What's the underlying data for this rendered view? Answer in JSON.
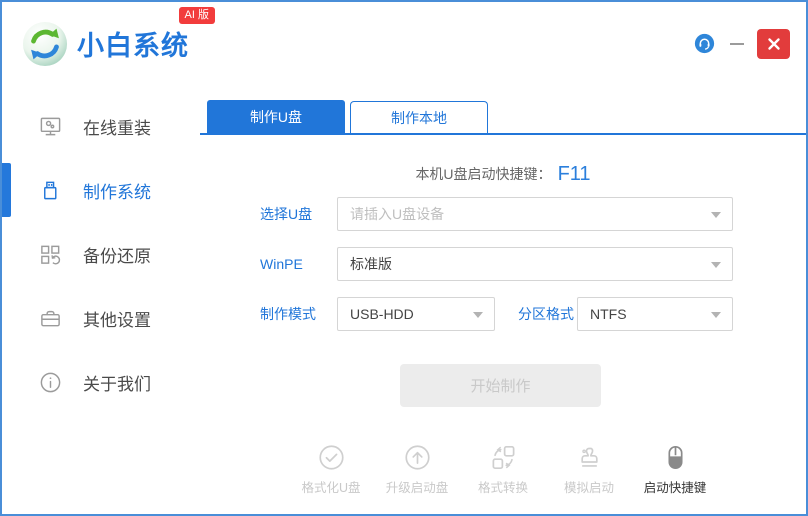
{
  "header": {
    "title": "小白系统",
    "badge": "AI 版"
  },
  "sidebar": {
    "items": [
      {
        "label": "在线重装",
        "icon": "monitor-icon",
        "active": false
      },
      {
        "label": "制作系统",
        "icon": "usb-drive-icon",
        "active": true
      },
      {
        "label": "备份还原",
        "icon": "backup-restore-icon",
        "active": false
      },
      {
        "label": "其他设置",
        "icon": "briefcase-icon",
        "active": false
      },
      {
        "label": "关于我们",
        "icon": "info-icon",
        "active": false
      }
    ]
  },
  "main": {
    "tabs": [
      {
        "label": "制作U盘",
        "active": true
      },
      {
        "label": "制作本地",
        "active": false
      }
    ],
    "hotkey_label": "本机U盘启动快捷键：",
    "hotkey_value": "F11",
    "form": {
      "usb_label": "选择U盘",
      "usb_placeholder": "请插入U盘设备",
      "winpe_label": "WinPE",
      "winpe_value": "标准版",
      "mode_label": "制作模式",
      "mode_value": "USB-HDD",
      "partition_label": "分区格式",
      "partition_value": "NTFS"
    },
    "start_button": "开始制作",
    "footer_tools": [
      {
        "label": "格式化U盘",
        "icon": "check-circle-icon",
        "active": false
      },
      {
        "label": "升级启动盘",
        "icon": "arrow-up-circle-icon",
        "active": false
      },
      {
        "label": "格式转换",
        "icon": "convert-icon",
        "active": false
      },
      {
        "label": "模拟启动",
        "icon": "stamp-icon",
        "active": false
      },
      {
        "label": "启动快捷键",
        "icon": "mouse-icon",
        "active": true
      }
    ]
  },
  "colors": {
    "primary_blue": "#2176d9",
    "badge_red": "#f23c3c",
    "close_red": "#e23c3c",
    "window_border": "#4a8ed8",
    "disabled_button_bg": "#ececec"
  }
}
